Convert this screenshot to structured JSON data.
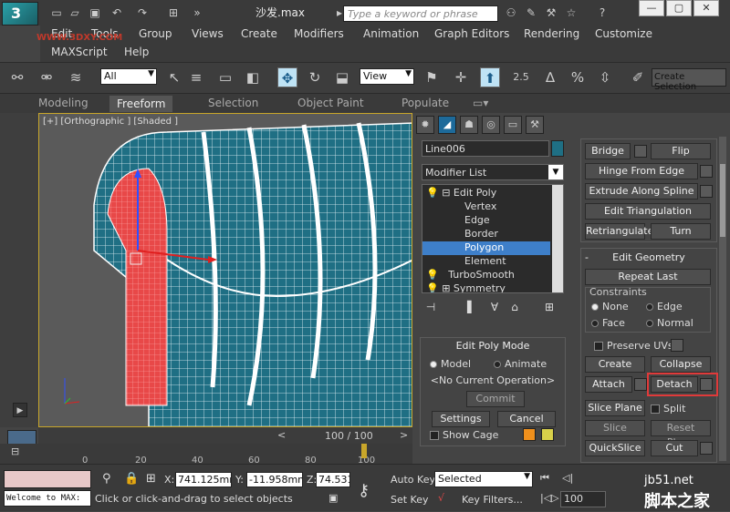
{
  "titlebar": {
    "doc_title": "沙发.max",
    "search_placeholder": "Type a keyword or phrase",
    "minimize": "—",
    "maximize": "▢",
    "close": "✕"
  },
  "watermark": "WWW.3DXY.COM",
  "menus": [
    "Edit",
    "Tools",
    "Group",
    "Views",
    "Create",
    "Modifiers",
    "Animation",
    "Graph Editors",
    "Rendering",
    "Customize",
    "MAXScript",
    "Help"
  ],
  "toolbar": {
    "selection_filter": "All",
    "ref_coord": "View",
    "snap_angle": "2.5",
    "create_selection_set": "Create Selection"
  },
  "ribbon_tabs": [
    "Modeling",
    "Freeform",
    "Selection",
    "Object Paint",
    "Populate"
  ],
  "viewport": {
    "label": "[+] [Orthographic ] [Shaded ]"
  },
  "command_panel": {
    "object_name": "Line006",
    "object_color": "#1f6f84",
    "modifier_list": "Modifier List",
    "stack": [
      {
        "label": "Edit Poly",
        "level": 0
      },
      {
        "label": "Vertex",
        "level": 1
      },
      {
        "label": "Edge",
        "level": 1
      },
      {
        "label": "Border",
        "level": 1
      },
      {
        "label": "Polygon",
        "level": 1,
        "selected": true
      },
      {
        "label": "Element",
        "level": 1
      },
      {
        "label": "TurboSmooth",
        "level": 0
      },
      {
        "label": "Symmetry",
        "level": 0
      }
    ],
    "edit_poly_mode": {
      "title": "Edit Poly Mode",
      "model": "Model",
      "animate": "Animate",
      "operation": "<No Current Operation>",
      "commit": "Commit",
      "settings": "Settings",
      "cancel": "Cancel",
      "show_cage": "Show Cage",
      "cage_color1": "#f0901c",
      "cage_color2": "#d8d04a"
    },
    "edit_polygons": {
      "bridge": "Bridge",
      "flip": "Flip",
      "hinge": "Hinge From Edge",
      "extrude_spline": "Extrude Along Spline",
      "edit_triangulation": "Edit Triangulation",
      "retriangulate": "Retriangulate",
      "turn": "Turn"
    },
    "edit_geometry": {
      "minus": "-",
      "title": "Edit Geometry",
      "repeat_last": "Repeat Last",
      "constraints": "Constraints",
      "none": "None",
      "edge": "Edge",
      "face": "Face",
      "normal": "Normal",
      "preserve_uvs": "Preserve UVs",
      "create": "Create",
      "collapse": "Collapse",
      "attach": "Attach",
      "detach": "Detach",
      "slice_plane": "Slice Plane",
      "split": "Split",
      "slice": "Slice",
      "reset_plane": "Reset Plane",
      "quickslice": "QuickSlice",
      "cut": "Cut"
    }
  },
  "timeline": {
    "slider": "100 / 100",
    "ticks": [
      "0",
      "20",
      "40",
      "60",
      "80",
      "100"
    ]
  },
  "status": {
    "maxscript_text": "Welcome to MAX:",
    "prompt": "Click or click-and-drag to select objects",
    "x_label": "X:",
    "x": "741.125mr",
    "y_label": "Y:",
    "y": "-11.958mm",
    "z_label": "Z:",
    "z": "74.531",
    "auto_key": "Auto Key",
    "set_key": "Set Key",
    "selected": "Selected",
    "key_filters": "Key Filters...",
    "frame": "100"
  },
  "site_watermark_1": "jb51.net",
  "site_watermark_2": "脚本之家"
}
